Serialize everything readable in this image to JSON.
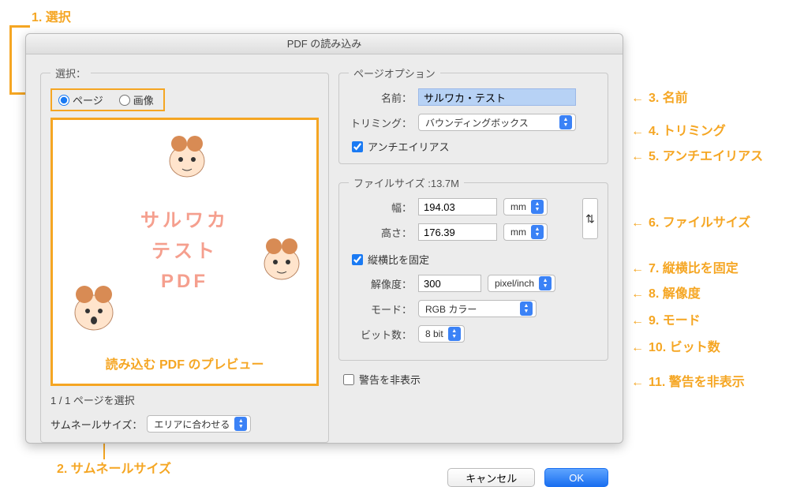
{
  "annotations": {
    "a1": "1. 選択",
    "a2": "2. サムネールサイズ",
    "a3": "3. 名前",
    "a4": "4. トリミング",
    "a5": "5. アンチエイリアス",
    "a6": "6. ファイルサイズ",
    "a7": "7. 縦横比を固定",
    "a8": "8. 解像度",
    "a9": "9. モード",
    "a10": "10. ビット数",
    "a11": "11. 警告を非表示"
  },
  "dialog": {
    "title": "PDF の読み込み"
  },
  "select_group": {
    "legend": "選択：",
    "radio_page": "ページ",
    "radio_image": "画像"
  },
  "preview": {
    "line1": "サルワカ",
    "line2": "テスト",
    "line3": "PDF",
    "caption": "読み込む PDF のプレビュー"
  },
  "page_info": "1 / 1 ページを選択",
  "thumbnail": {
    "label": "サムネールサイズ：",
    "value": "エリアに合わせる"
  },
  "page_options": {
    "legend": "ページオプション",
    "name_label": "名前：",
    "name_value": "サルワカ・テスト",
    "trim_label": "トリミング：",
    "trim_value": "バウンディングボックス",
    "antialias": "アンチエイリアス"
  },
  "file_size": {
    "legend": "ファイルサイズ :13.7M",
    "width_label": "幅：",
    "width_value": "194.03",
    "height_label": "高さ：",
    "height_value": "176.39",
    "unit": "mm",
    "constrain": "縦横比を固定",
    "res_label": "解像度：",
    "res_value": "300",
    "res_unit": "pixel/inch",
    "mode_label": "モード：",
    "mode_value": "RGB カラー",
    "bits_label": "ビット数：",
    "bits_value": "8 bit"
  },
  "suppress_warnings": "警告を非表示",
  "buttons": {
    "cancel": "キャンセル",
    "ok": "OK"
  }
}
